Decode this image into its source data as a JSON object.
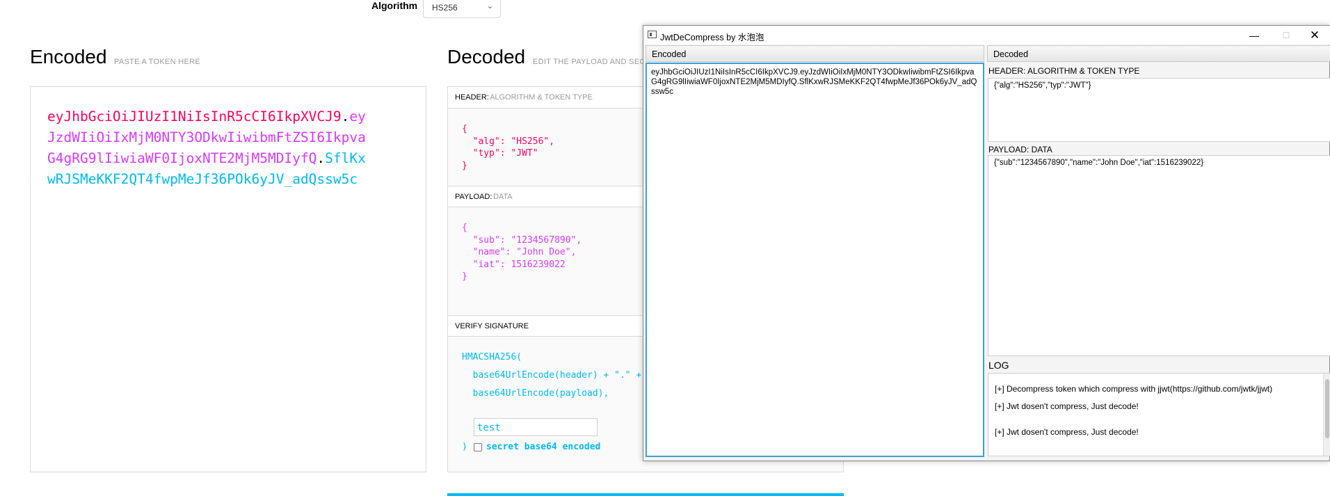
{
  "algorithm": {
    "label": "Algorithm",
    "value": "HS256"
  },
  "encoded": {
    "title": "Encoded",
    "subtitle": "PASTE A TOKEN HERE",
    "token_lines": [
      [
        {
          "text": "eyJhbGciOiJIUzI1NiIsInR5cCI6IkpXVCJ9",
          "color": "red"
        },
        {
          "text": ".",
          "color": "dot"
        },
        {
          "text": "ey",
          "color": "pur"
        }
      ],
      [
        {
          "text": "JzdWIiOiIxMjM0NTY3ODkwIiwibmFtZSI6Ikpva",
          "color": "pur"
        }
      ],
      [
        {
          "text": "G4gRG9lIiwiaWF0IjoxNTE2MjM5MDIyfQ",
          "color": "pur"
        },
        {
          "text": ".",
          "color": "dot"
        },
        {
          "text": "SflKx",
          "color": "cyan"
        }
      ],
      [
        {
          "text": "wRJSMeKKF2QT4fwpMeJf36POk6yJV_adQssw5c",
          "color": "cyan"
        }
      ]
    ]
  },
  "decoded": {
    "title": "Decoded",
    "subtitle": "EDIT THE PAYLOAD AND SECRET",
    "header_section": {
      "key": "HEADER:",
      "desc": "ALGORITHM & TOKEN TYPE"
    },
    "header_json": [
      [
        {
          "t": "{",
          "c": "red"
        }
      ],
      [
        {
          "t": "  \"alg\"",
          "c": "red"
        },
        {
          "t": ": ",
          "c": "red"
        },
        {
          "t": "\"HS256\"",
          "c": "red"
        },
        {
          "t": ",",
          "c": "red"
        }
      ],
      [
        {
          "t": "  \"typ\"",
          "c": "red"
        },
        {
          "t": ": ",
          "c": "red"
        },
        {
          "t": "\"JWT\"",
          "c": "red"
        }
      ],
      [
        {
          "t": "}",
          "c": "red"
        }
      ]
    ],
    "payload_section": {
      "key": "PAYLOAD:",
      "desc": "DATA"
    },
    "payload_json": [
      [
        {
          "t": "{",
          "c": "pur"
        }
      ],
      [
        {
          "t": "  \"sub\"",
          "c": "pur"
        },
        {
          "t": ": ",
          "c": "pur"
        },
        {
          "t": "\"1234567890\"",
          "c": "pur"
        },
        {
          "t": ",",
          "c": "pur"
        }
      ],
      [
        {
          "t": "  \"name\"",
          "c": "pur"
        },
        {
          "t": ": ",
          "c": "pur"
        },
        {
          "t": "\"John Doe\"",
          "c": "pur"
        },
        {
          "t": ",",
          "c": "pur"
        }
      ],
      [
        {
          "t": "  \"iat\"",
          "c": "pur"
        },
        {
          "t": ": ",
          "c": "pur"
        },
        {
          "t": "1516239022",
          "c": "pur"
        }
      ],
      [
        {
          "t": "}",
          "c": "pur"
        }
      ]
    ],
    "verify_section": {
      "key": "VERIFY SIGNATURE"
    },
    "verify_lines": [
      "HMACSHA256(",
      "  base64UrlEncode(header) + \".\" +",
      "  base64UrlEncode(payload),"
    ],
    "secret": "test",
    "verify_close": ")",
    "base64_label": "secret base64 encoded"
  },
  "window": {
    "title": "JwtDeCompress by 水泡泡",
    "encoded_header": "Encoded",
    "encoded_text": "eyJhbGciOiJIUzI1NiIsInR5cCI6IkpXVCJ9.eyJzdWIiOiIxMjM0NTY3ODkwIiwibmFtZSI6IkpvaG4gRG9lIiwiaWF0IjoxNTE2MjM5MDIyfQ.SflKxwRJSMeKKF2QT4fwpMeJf36POk6yJV_adQssw5c",
    "decoded_header": "Decoded",
    "header_label": "HEADER:  ALGORITHM & TOKEN TYPE",
    "header_value": "{\"alg\":\"HS256\",\"typ\":\"JWT\"}",
    "payload_label": "PAYLOAD: DATA",
    "payload_value": "{\"sub\":\"1234567890\",\"name\":\"John Doe\",\"iat\":1516239022}",
    "log_label": "LOG",
    "log_lines": [
      "[+] Decompress token which compress with jjwt(https://github.com/jwtk/jjwt)",
      "[+] Jwt dosen't compress, Just decode!",
      "[+] Jwt dosen't compress, Just decode!"
    ],
    "controls": {
      "minimize": "—",
      "maximize": "☐",
      "close": "✕"
    }
  }
}
